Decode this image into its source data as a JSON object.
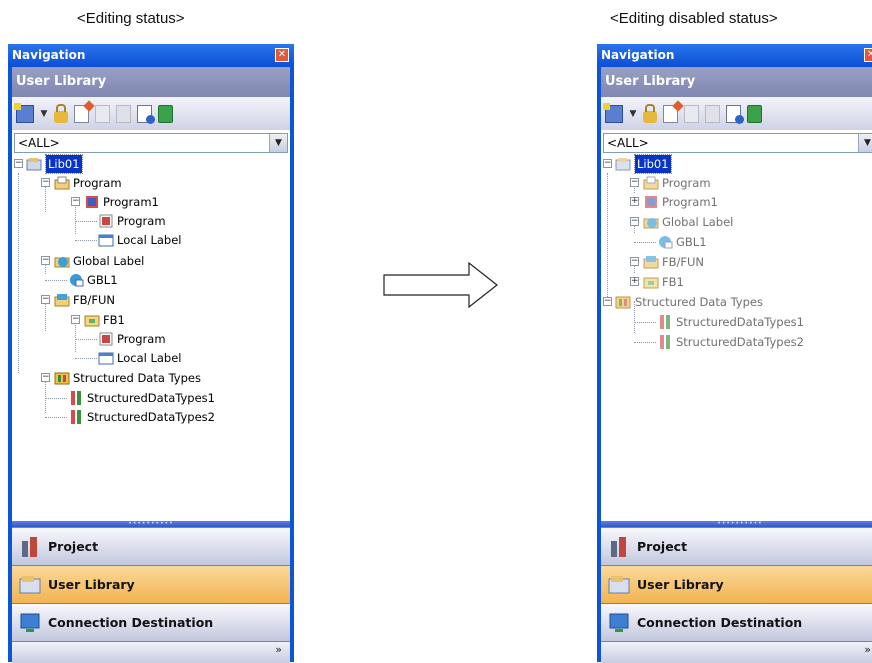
{
  "captions": {
    "left": "<Editing status>",
    "right": "<Editing disabled status>"
  },
  "panel": {
    "title": "Navigation",
    "library_header": "User Library",
    "filter_value": "<ALL>",
    "nav_buttons": {
      "project": "Project",
      "user_library": "User Library",
      "connection": "Connection Destination"
    },
    "footer_chevron": "»"
  },
  "icons": {
    "close": "close-icon",
    "new_data": "new-data-icon",
    "lock": "lock-icon",
    "add_item": "add-item-icon",
    "copy": "copy-icon",
    "paste": "paste-icon",
    "properties": "properties-icon",
    "refresh": "refresh-icon",
    "library": "library-icon",
    "program_folder": "program-folder-icon",
    "program": "program-icon",
    "local_label": "local-label-icon",
    "global_label": "global-label-icon",
    "fb_fun": "fb-fun-icon",
    "fb": "fb-icon",
    "structured_types": "structured-data-types-icon",
    "project": "project-icon",
    "connection": "connection-icon"
  },
  "tree_editing": {
    "root": "Lib01",
    "program_folder": "Program",
    "program1": "Program1",
    "program1_program": "Program",
    "program1_local_label": "Local Label",
    "global_label": "Global Label",
    "gbl1": "GBL1",
    "fbfun": "FB/FUN",
    "fb1": "FB1",
    "fb1_program": "Program",
    "fb1_local_label": "Local Label",
    "structured": "Structured Data Types",
    "sdt1": "StructuredDataTypes1",
    "sdt2": "StructuredDataTypes2"
  },
  "tree_disabled": {
    "root": "Lib01",
    "program_folder": "Program",
    "program1": "Program1",
    "global_label": "Global Label",
    "gbl1": "GBL1",
    "fbfun": "FB/FUN",
    "fb1": "FB1",
    "structured": "Structured Data Types",
    "sdt1": "StructuredDataTypes1",
    "sdt2": "StructuredDataTypes2"
  },
  "colors": {
    "window_border": "#0a56d6",
    "selected_nav": "#f2b351",
    "selection": "#0a34c8"
  }
}
